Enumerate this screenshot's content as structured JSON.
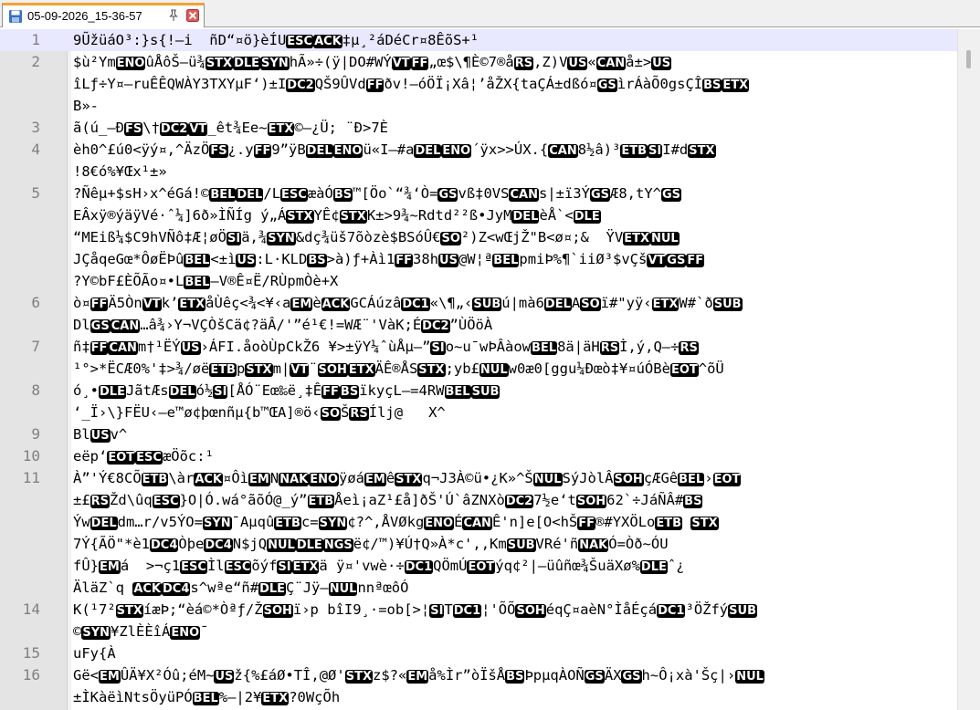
{
  "tab": {
    "title": "05-09-2026_15-36-57"
  },
  "icons": {
    "save": "save-icon",
    "pin": "pin-icon",
    "close": "close-icon"
  },
  "colors": {
    "tab_accent": "#f4a234",
    "current_line": "#e8e8ff",
    "close_icon": "#d9534f",
    "gutter_bg": "#e4e4e4"
  },
  "current_line": 1,
  "lines": [
    {
      "num": "1",
      "text": "9ŨžüáO³:}s{!—i  ñD“¤ö}èÍU{{ESC}}{{ACK}}‡µ¸²áDéCr¤8ÊõS+¹"
    },
    {
      "num": "2",
      "text": "$ù²Ym{{ENO}}ûÅôŠ–ü¾{{STX}}{{DLE}}{{SYN}}hÃ»÷(ÿ|DO#WÝ{{VT}}{{FF}}„œ$\\¶È©7®å{{RS}},Z)V{{US}}«{{CAN}}å±>{{US}}"
    },
    {
      "num": "",
      "text": "îLƒ÷Y¤–ruÊÊQWÀY3TXYµF‘)±I{{DC2}}QŠ9ÛVd{{FF}}ðv!–óÖÏ¡Xâ¦’åŽX{taÇÁ±dßó¤{{GS}}ìrÁàÕ0gsÇÎ{{BS}}{{ETX}}"
    },
    {
      "num": "",
      "text": "B»-"
    },
    {
      "num": "3",
      "text": "ã(ú_–Ð{{FS}}\\†{{DC2}}{{VT}}_êt¾Ee~{{ETX}}©—¿Ü; ¨Ð>7È"
    },
    {
      "num": "4",
      "text": "èh0^£ú0<ÿý¤,^ÄzÖ{{FS}}¿.y{{FF}}9”ÿB{{DEL}}{{ENO}}ü«I–#a{{DEL}}{{ENO}}´ÿx>>ÚX.{{{CAN}}8½â)³{{ETB}}{{SI}}I#d{{STX}}"
    },
    {
      "num": "",
      "text": "!8€ó%¥Œx¹±»"
    },
    {
      "num": "5",
      "text": "?Ñêµ+$sH›x^éGá!©{{BEL}}{{DEL}}/L{{ESC}}æàÓ{{BS}}™[Öo`“¾‘Ò={{GS}}vß‡0VS{{CAN}}s|±ï3Ý{{GS}}Æ8,tY^{{GS}}"
    },
    {
      "num": "",
      "text": "EÂxÿ®ýäÿVé·ˆ¼]6ð»ÌÑÍg ý„Á{{STX}}YÊ¢{{STX}}K±>9¾~Rdtd²²ß•JyM{{DEL}}èÅ`<{{DLE}}"
    },
    {
      "num": "",
      "text": "“MEiß¼$C9hVÑô‡Æ¦øÖ{{SI}}ä,¾{{SYN}}&dç¾üš7õòzè$BSóÛ€{{SO}}²)Z<wŒjŽ\"B<ø¤;&  ŸV{{ETX}}{{NUL}}"
    },
    {
      "num": "",
      "text": "JÇåqeGœ*ÔøËÞû{{BEL}}<±ì{{US}}:L·KLD{{BS}}>à)ƒ+Àì1{{FF}}38h{{US}}@W¦ª{{BEL}}pmiÞ%¶`iiØ³$vÇš{{VT}}{{GS}}{{FF}}"
    },
    {
      "num": "",
      "text": "?Y©bF£ÈÕÃo¤•L{{BEL}}—V®Ê¤Ë/RÙpmÒè+X"
    },
    {
      "num": "6",
      "text": "ò¤{{FF}}Ä5Òn{{VT}}k’{{ETX}}åÙêç<¾<¥‹a{{EM}}è{{ACK}}GCÁúzâ{{DC1}}«\\¶„‹{{SUB}}ú|mà6{{DEL}}A{{SO}}ï#\"yÿ‹{{ETX}}W#`ð{{SUB}}"
    },
    {
      "num": "",
      "text": "Dl{{GS}}{{CAN}}…â¾›Y¬VÇÒšCä¢?äÂ/'”é¹€!=WÆ¨'VàK;É{{DC2}}”ÙÖöÀ"
    },
    {
      "num": "7",
      "text": "ñ‡{{FF}}{{CAN}}m†¹ËÝ{{US}}›ÁFI.åoòÙpCkŽ6 ¥>±ÿY¼ˆùÅµ–”{{SI}}o~u¯wÞÂàow{{BEL}}8ä|äH{{RS}}Ì,ý,Q—÷{{RS}}"
    },
    {
      "num": "",
      "text": "¹°>*ËCÆ0%'‡>¾/øë{{ETB}}p{{STX}}m|{{VT}}¨{{SOH}}{{ETX}}ÄÊ®ÅS{{STX}};yb£{{NUL}}w0æ0[ggu¼Ðœò‡¥¤úÓBè{{EOT}}^õÜ"
    },
    {
      "num": "8",
      "text": "ó¸•{{DLE}}JãtÆs{{DEL}}ó½{{SI}}[ÅÓ¨Eœ‰ë¸‡Ê{{FF}}{{BS}}ïkyçL—=4RW{{BEL}}{{SUB}}"
    },
    {
      "num": "",
      "text": "‘_Ï›\\}FËU‹–e™ø¢þœnñµ{b™ŒA]®ö‹{{SO}}Š{{RS}}Ílj@   X^"
    },
    {
      "num": "9",
      "text": "Bl{{US}}v^"
    },
    {
      "num": "10",
      "text": "eëp‘{{EOT}}{{ESC}}æÖõc:¹"
    },
    {
      "num": "11",
      "text": "À”'Ý€8CÕ{{ETB}}\\àr{{ACK}}¤Ôì{{EM}}N{{NAK}}{{ENO}}ÿøá{{EM}}ê{{STX}}q¬J3À©ü•¿K»^Š{{NUL}}SýJòlÂ{{SOH}}çÆGê{{BEL}}›{{EOT}}"
    },
    {
      "num": "",
      "text": "±£{{RS}}Žd\\ûq{{ESC}}}O|Ó.wá°ãõÓ@_ý”{{ETB}}Åeì¡aZ¹£å]ðŠ'Ú`âZNXò{{DC2}}7½e‘t{{SOH}}62`÷JáÑÂ#{{BS}}"
    },
    {
      "num": "",
      "text": "Ýw{{DEL}}dm…r/v5ÝO={{SYN}}¯Aµqû{{ETB}}c={{SYN}}¢?^,ÅVØkg{{ENO}}É{{CAN}}Ê'n]e[O<hŠ{{FF}}®#YXÖLo{{ETB}} {{STX}}"
    },
    {
      "num": "",
      "text": "7Ý{ÃÖ\"*è1{{DC4}}Òþe{{DC4}}N$jQ{{NUL}}{{DLE}}{{NGS}}ë¢/™)¥Ú†Q»À*c',,Km{{SUB}}VRé'ñ{{NAK}}Ó=Òð~ÓU"
    },
    {
      "num": "",
      "text": "fÛ}{{EM}}á  >¬ç1{{ESC}}Ìl{{ESC}}õýf{{SI}}{{ETX}}ä ÿ¤'vwè·÷{{DC1}}QÖmÚ{{EOT}}ýq¢²|—üûñœ¾ŠuäXø%{{DLE}}ˆ¿"
    },
    {
      "num": "",
      "text": "ÄläZ`q {{ACK}}{{DC4}}s^wªe“ñ#{{DLE}}Ç¨Jÿ–{{NUL}}nnªœôÓ"
    },
    {
      "num": "14",
      "text": "K(¹7²{{STX}}íæÞ;“èá©*Òªƒ/Ž{{SOH}}ï›p bîI9¸·=ob[>¦{{SI}}T{{DC1}}¦'ÕÕ{{SOH}}éqÇ¤aèN°ÌåÉçá{{DC1}}³ÖŽfý{{SUB}}"
    },
    {
      "num": "",
      "text": "©{{SYN}}¥ZlÈÈîÁ{{ENO}}¯"
    },
    {
      "num": "15",
      "text": "uFy{À"
    },
    {
      "num": "16",
      "text": "Gë<{{EM}}ÛÄ¥X²Óû;éM~{{US}}ž{%£áØ•TÎ,@Ø'{{STX}}z$?«{{EM}}å%Ìr”òÏšÅ{{BS}}ÞpµqÀOÑ{{GS}}ÄX{{GS}}h~Ô¡xà'Šç|›{{NUL}}"
    },
    {
      "num": "",
      "text": "±ÌKàëìNtsÖyüPÓ{{BEL}}%–|2¥{{ETX}}?0WçÕh"
    }
  ]
}
